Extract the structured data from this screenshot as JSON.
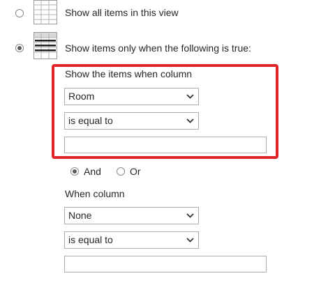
{
  "view_filter": {
    "option_all_label": "Show all items in this view",
    "option_conditional_label": "Show items only when the following is true:",
    "selected_option": "conditional"
  },
  "condition_1": {
    "heading": "Show the items when column",
    "column_value": "Room",
    "operator_value": "is equal to",
    "value_text": ""
  },
  "logic": {
    "and_label": "And",
    "or_label": "Or",
    "selected": "And"
  },
  "condition_2": {
    "heading": "When column",
    "column_value": "None",
    "operator_value": "is equal to",
    "value_text": ""
  },
  "colors": {
    "highlight_border": "#e0222b"
  },
  "icons": {
    "all_items": "table-grid-icon",
    "conditional": "filtered-table-icon",
    "dropdown": "chevron-down-icon"
  }
}
